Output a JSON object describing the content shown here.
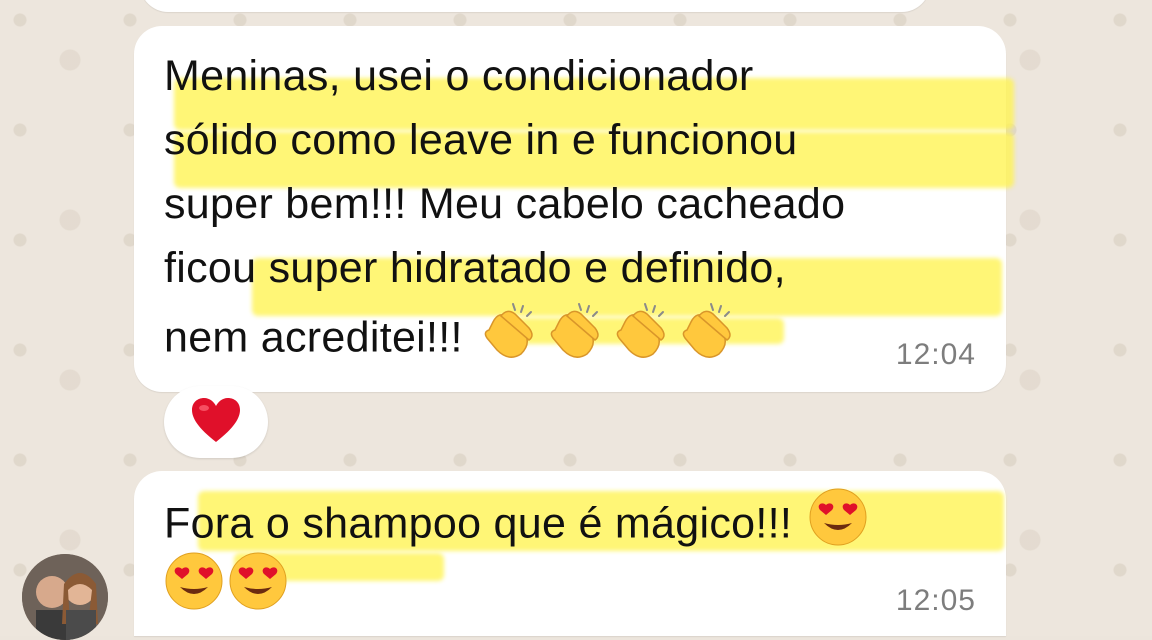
{
  "chat": {
    "messages": [
      {
        "lines": [
          "Meninas, usei o condicionador",
          "sólido como leave in e funcionou",
          "super bem!!! Meu cabelo cacheado",
          "ficou super hidratado e definido,",
          "nem acreditei!!!"
        ],
        "emojis": [
          "clapping-hands-emoji",
          "clapping-hands-emoji",
          "clapping-hands-emoji",
          "clapping-hands-emoji"
        ],
        "time": "12:04",
        "reaction": "red-heart-emoji"
      },
      {
        "lines": [
          "Fora o shampoo que é mágico!!!"
        ],
        "emojis": [
          "smiling-face-with-heart-eyes-emoji",
          "smiling-face-with-heart-eyes-emoji",
          "smiling-face-with-heart-eyes-emoji"
        ],
        "time": "12:05"
      }
    ]
  },
  "colors": {
    "wallpaper": "#ECE5DC",
    "bubble": "#FFFFFF",
    "highlight": "#FFF450",
    "text": "#111111",
    "timestamp": "#7D7D7D",
    "heart": "#E0102A",
    "emoji_yellow": "#FFC83D"
  }
}
